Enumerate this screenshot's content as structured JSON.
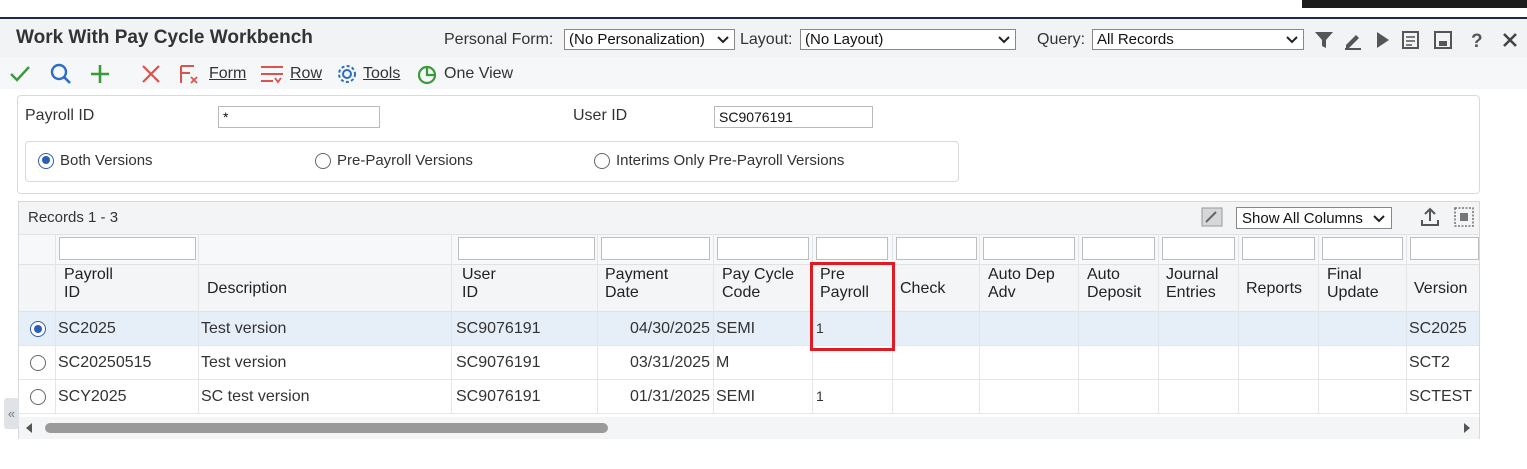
{
  "form": {
    "title": "Work With Pay Cycle Workbench",
    "personal_form_label": "Personal Form:",
    "personal_form_value": "(No Personalization)",
    "layout_label": "Layout:",
    "layout_value": "(No Layout)",
    "query_label": "Query:",
    "query_value": "All Records"
  },
  "toolbar": {
    "form_label": "Form",
    "row_label": "Row",
    "tools_label": "Tools",
    "oneview_label": "One View"
  },
  "criteria": {
    "payroll_id_label": "Payroll ID",
    "payroll_id_value": "*",
    "user_id_label": "User ID",
    "user_id_value": "SC9076191",
    "radios": [
      {
        "label": "Both Versions",
        "selected": true
      },
      {
        "label": "Pre-Payroll Versions",
        "selected": false
      },
      {
        "label": "Interims Only Pre-Payroll Versions",
        "selected": false
      }
    ]
  },
  "grid": {
    "records_label": "Records 1 - 3",
    "show_columns": "Show All Columns",
    "columns": [
      {
        "l1": "Payroll",
        "l2": "ID"
      },
      {
        "l1": "Description",
        "l2": ""
      },
      {
        "l1": "User",
        "l2": "ID"
      },
      {
        "l1": "Payment",
        "l2": "Date"
      },
      {
        "l1": "Pay Cycle",
        "l2": "Code"
      },
      {
        "l1": "Pre",
        "l2": "Payroll"
      },
      {
        "l1": "Check",
        "l2": ""
      },
      {
        "l1": "Auto Dep",
        "l2": "Adv"
      },
      {
        "l1": "Auto",
        "l2": "Deposit"
      },
      {
        "l1": "Journal",
        "l2": "Entries"
      },
      {
        "l1": "Reports",
        "l2": ""
      },
      {
        "l1": "Final",
        "l2": "Update"
      },
      {
        "l1": "Version",
        "l2": ""
      }
    ],
    "rows": [
      {
        "selected": true,
        "payroll_id": "SC2025",
        "description": "Test version",
        "user_id": "SC9076191",
        "payment_date": "04/30/2025",
        "pay_cycle_code": "SEMI",
        "pre_payroll": "1",
        "version": "SC2025"
      },
      {
        "selected": false,
        "payroll_id": "SC20250515",
        "description": "Test version",
        "user_id": "SC9076191",
        "payment_date": "03/31/2025",
        "pay_cycle_code": "M",
        "pre_payroll": "",
        "version": "SCT2"
      },
      {
        "selected": false,
        "payroll_id": "SCY2025",
        "description": "SC test version",
        "user_id": "SC9076191",
        "payment_date": "01/31/2025",
        "pay_cycle_code": "SEMI",
        "pre_payroll": "1",
        "version": "SCTEST"
      }
    ]
  },
  "colors": {
    "accent": "#2b5eb8",
    "highlight": "#e01b24",
    "ok_green": "#3a9a3a",
    "cancel_red": "#d9534f"
  },
  "collapse_glyph": "«"
}
